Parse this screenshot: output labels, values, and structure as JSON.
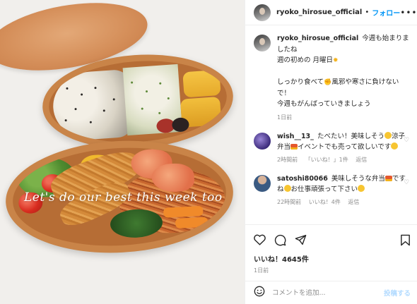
{
  "photo": {
    "overlay_text": "Let's do our best this week too"
  },
  "header": {
    "username": "ryoko_hirosue_official",
    "separator": "•",
    "follow_label": "フォロー",
    "more_label": "•••"
  },
  "caption": {
    "username": "ryoko_hirosue_official",
    "line1": "今週も始まりましたね",
    "line2": "週の初めの 月曜日",
    "line3": "しっかり食べて",
    "line4": "風邪や寒さに負けないで！",
    "line5": "今週もがんばっていきましょう",
    "time": "1日前"
  },
  "comments": [
    {
      "username": "wish__13_",
      "text_a": "たべたい！美味しそう",
      "text_b": "涼子弁当",
      "text_c": "イベントでも売って欲しいです",
      "time": "2時間前",
      "likes": "「いいね！」1件",
      "reply": "返信"
    },
    {
      "username": "satoshi80066",
      "text_a": "美味しそうな弁当",
      "text_b": "ですね",
      "text_c": "お仕事頑張って下さい",
      "time": "22時間前",
      "likes": "いいね！4件",
      "reply": "返信"
    }
  ],
  "actions": {
    "likes": "いいね！4645件",
    "time": "1日前"
  },
  "add_comment": {
    "placeholder": "コメントを追加...",
    "post_label": "投稿する"
  },
  "icons": {
    "heart": "heart-icon",
    "comment": "comment-icon",
    "share": "share-icon",
    "save": "bookmark-icon",
    "emoji": "emoji-icon"
  },
  "colors": {
    "link_blue": "#0095f6",
    "post_disabled": "#b3dbff",
    "muted": "#8e8e8e"
  }
}
